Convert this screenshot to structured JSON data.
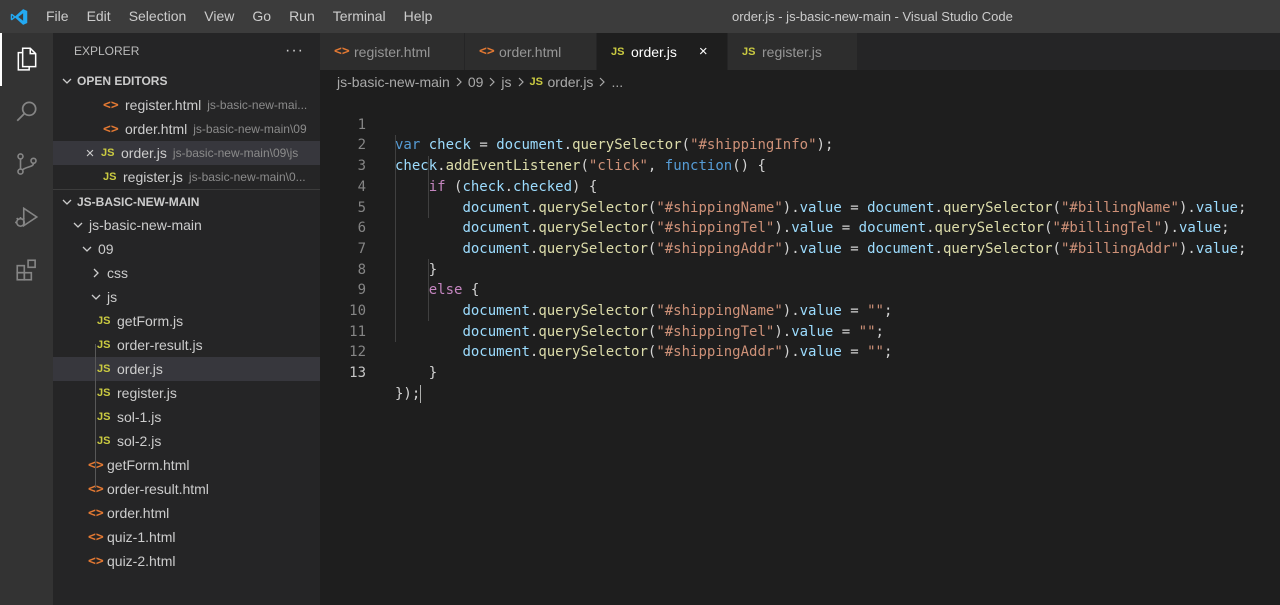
{
  "titlebar": {
    "menu": [
      "File",
      "Edit",
      "Selection",
      "View",
      "Go",
      "Run",
      "Terminal",
      "Help"
    ],
    "title": "order.js - js-basic-new-main - Visual Studio Code"
  },
  "activity_bar": {
    "items": [
      "files-icon",
      "search-icon",
      "source-control-icon",
      "run-debug-icon",
      "extensions-icon"
    ]
  },
  "explorer": {
    "header": "EXPLORER",
    "more": "···",
    "open_editors": {
      "title": "OPEN EDITORS",
      "items": [
        {
          "name": "register.html",
          "desc": "js-basic-new-mai...",
          "type": "html"
        },
        {
          "name": "order.html",
          "desc": "js-basic-new-main\\09",
          "type": "html"
        },
        {
          "name": "order.js",
          "desc": "js-basic-new-main\\09\\js",
          "type": "js"
        },
        {
          "name": "register.js",
          "desc": "js-basic-new-main\\0...",
          "type": "js"
        }
      ]
    },
    "folder": {
      "title": "JS-BASIC-NEW-MAIN",
      "root": "js-basic-new-main",
      "sub": "09",
      "css": "css",
      "js": "js",
      "js_files": [
        "getForm.js",
        "order-result.js",
        "order.js",
        "register.js",
        "sol-1.js",
        "sol-2.js"
      ],
      "html_files": [
        "getForm.html",
        "order-result.html",
        "order.html",
        "quiz-1.html",
        "quiz-2.html"
      ]
    },
    "icons": {
      "html": "<>",
      "js": "JS",
      "close": "×"
    }
  },
  "tabs": [
    {
      "label": "register.html",
      "type": "html"
    },
    {
      "label": "order.html",
      "type": "html"
    },
    {
      "label": "order.js",
      "type": "js",
      "active": true
    },
    {
      "label": "register.js",
      "type": "js"
    }
  ],
  "breadcrumb": {
    "parts": [
      "js-basic-new-main",
      "09",
      "js",
      "order.js",
      "..."
    ]
  },
  "editor": {
    "line_numbers": [
      "1",
      "2",
      "3",
      "4",
      "5",
      "6",
      "7",
      "8",
      "9",
      "10",
      "11",
      "12",
      "13"
    ],
    "current_line": 13,
    "code": {
      "l1": {
        "kw": "var",
        "v1": "check",
        "eq": " = ",
        "v2": "document",
        "dot": ".",
        "fn": "querySelector",
        "p1": "(",
        "str": "\"#shippingInfo\"",
        "p2": ");"
      },
      "l2": {
        "v1": "check",
        "dot": ".",
        "fn": "addEventListener",
        "p1": "(",
        "str": "\"click\"",
        "comma": ", ",
        "kw": "function",
        "p2": "() {"
      },
      "l3": {
        "kw": "if",
        "p1": " (",
        "v1": "check",
        "dot": ".",
        "v2": "checked",
        "p2": ") {"
      },
      "l4": {
        "a": "document",
        "f1": "querySelector",
        "s1": "\"#shippingName\"",
        "b": "value",
        "c": "document",
        "f2": "querySelector",
        "s2": "\"#billingName\"",
        "d": "value"
      },
      "l5": {
        "a": "document",
        "f1": "querySelector",
        "s1": "\"#shippingTel\"",
        "b": "value",
        "c": "document",
        "f2": "querySelector",
        "s2": "\"#billingTel\"",
        "d": "value"
      },
      "l6": {
        "a": "document",
        "f1": "querySelector",
        "s1": "\"#shippingAddr\"",
        "b": "value",
        "c": "document",
        "f2": "querySelector",
        "s2": "\"#billingAddr\"",
        "d": "value"
      },
      "l7": {
        "p": "}"
      },
      "l8": {
        "kw": "else",
        "p": " {"
      },
      "l9": {
        "a": "document",
        "f1": "querySelector",
        "s1": "\"#shippingName\"",
        "b": "value",
        "s2": "\"\""
      },
      "l10": {
        "a": "document",
        "f1": "querySelector",
        "s1": "\"#shippingTel\"",
        "b": "value",
        "s2": "\"\""
      },
      "l11": {
        "a": "document",
        "f1": "querySelector",
        "s1": "\"#shippingAddr\"",
        "b": "value",
        "s2": "\"\""
      },
      "l12": {
        "p": "}"
      },
      "l13": {
        "p": "});"
      }
    }
  },
  "colors": {
    "keyword": "#569cd6",
    "control": "#c586c0",
    "variable": "#9cdcfe",
    "function": "#dcdcaa",
    "string": "#ce9178",
    "html_icon": "#e37933",
    "js_icon": "#cbcb41",
    "vscode_blue": "#23a9f2"
  }
}
